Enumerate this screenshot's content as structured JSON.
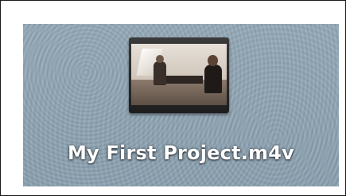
{
  "desktop": {
    "items": [
      {
        "filename": "My First Project.m4v",
        "icon": "movie-file-icon"
      }
    ]
  }
}
